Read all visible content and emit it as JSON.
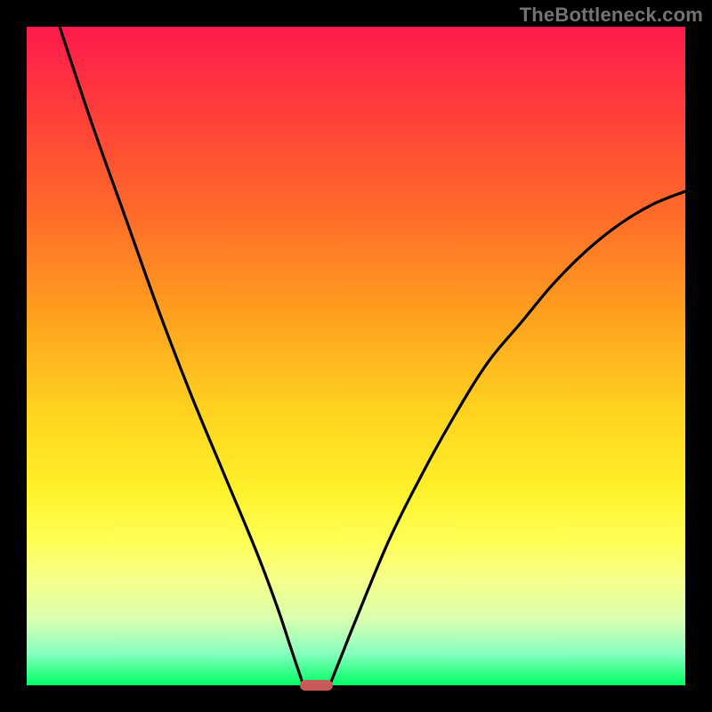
{
  "watermark": "TheBottleneck.com",
  "colors": {
    "frame": "#000000",
    "curve": "#000000",
    "marker": "#c85a5a",
    "gradient_top": "#ff1a4d",
    "gradient_bottom": "#00ff66"
  },
  "chart_data": {
    "type": "line",
    "title": "",
    "xlabel": "",
    "ylabel": "",
    "xlim": [
      0,
      100
    ],
    "ylim": [
      0,
      100
    ],
    "grid": false,
    "legend": false,
    "series": [
      {
        "name": "left-curve",
        "x": [
          5,
          10,
          15,
          20,
          25,
          30,
          35,
          38,
          40,
          41,
          42
        ],
        "values": [
          100,
          85,
          71,
          57,
          44,
          32,
          20,
          12,
          6,
          3,
          0
        ]
      },
      {
        "name": "right-curve",
        "x": [
          46,
          48,
          50,
          55,
          60,
          65,
          70,
          75,
          80,
          85,
          90,
          95,
          100
        ],
        "values": [
          0,
          5,
          10,
          22,
          32,
          41,
          49,
          55,
          61,
          66,
          70,
          73,
          75
        ]
      }
    ],
    "marker": {
      "x_center": 44,
      "y": 0,
      "width_pct": 5,
      "height_pct": 1.5
    }
  }
}
